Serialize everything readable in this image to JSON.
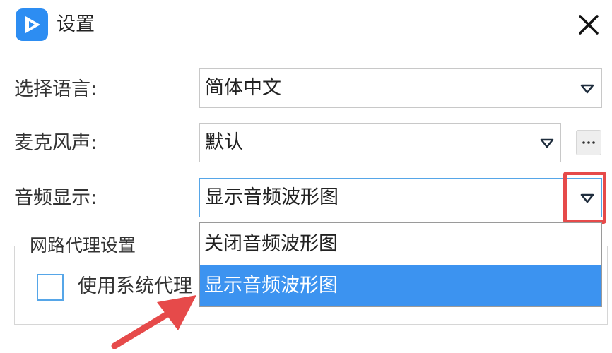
{
  "window": {
    "title": "设置",
    "logo_icon": "play-logo-icon",
    "close_icon": "close-icon"
  },
  "language": {
    "label": "选择语言:",
    "value": "简体中文"
  },
  "microphone": {
    "label": "麦克风声:",
    "value": "默认",
    "more_label": "..."
  },
  "audio_display": {
    "label": "音频显示:",
    "value": "显示音频波形图",
    "options": [
      "关闭音频波形图",
      "显示音频波形图"
    ],
    "selected_index": 1
  },
  "proxy": {
    "group_title": "网路代理设置",
    "checkbox_label": "使用系统代理",
    "checked": false
  },
  "colors": {
    "accent": "#3c93f0",
    "focus_border": "#56a6e8",
    "annotation": "#e64a4a"
  }
}
